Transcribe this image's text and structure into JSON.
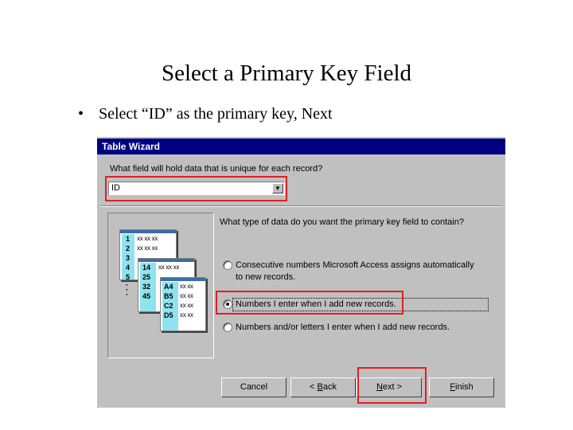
{
  "slide": {
    "title": "Select a Primary Key Field",
    "bullet_symbol": "•",
    "bullet_text": "Select “ID” as the primary key, Next"
  },
  "dialog": {
    "title": "Table Wizard",
    "unique_field_prompt": "What field will hold data that is unique for each record?",
    "field_select": {
      "value": "ID",
      "arrow": "▼"
    },
    "datatype_prompt": "What type of data do you want the primary key field to contain?",
    "options": [
      {
        "line1": "Consecutive numbers Microsoft Access assigns automatically",
        "line2": "to new records.",
        "selected": false
      },
      {
        "line1": "Numbers I enter when I add new records.",
        "selected": true
      },
      {
        "line1": "Numbers and/or letters I enter when I add new records.",
        "selected": false
      }
    ],
    "illustration": {
      "sheet1_keys": [
        "1",
        "2",
        "3",
        "4",
        "5"
      ],
      "sheet2_keys": [
        "14",
        "25",
        "32",
        "45"
      ],
      "sheet3_keys": [
        "A4",
        "B5",
        "C2",
        "D5"
      ],
      "filler": "xx xx xx",
      "filler_short": "xx xx"
    },
    "buttons": {
      "cancel": "Cancel",
      "back_accel": "<",
      "back_rest": " Back",
      "back_prefix": "< ",
      "back_ul": "B",
      "back_tail": "ack",
      "next_ul": "N",
      "next_tail": "ext >",
      "finish_ul": "F",
      "finish_tail": "inish"
    },
    "colors": {
      "highlight": "#e02020",
      "titlebar": "#000080",
      "key_column": "#8fe3ef"
    }
  }
}
